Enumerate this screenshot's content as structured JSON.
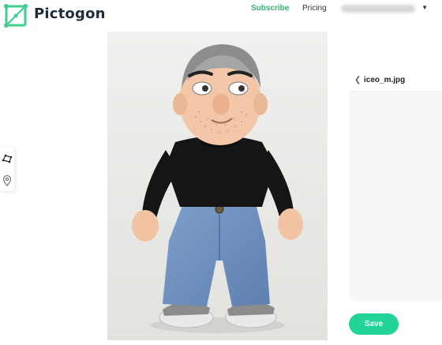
{
  "header": {
    "brand": "Pictogon",
    "logo_icon": "pictogon-logo-icon",
    "nav": {
      "subscribe": "Subscribe",
      "pricing": "Pricing"
    },
    "account": {
      "caret_icon": "caret-down-icon"
    },
    "accent_color": "#2bb673"
  },
  "toolbar": {
    "tools": [
      "polygon-tool-icon",
      "location-pin-icon"
    ]
  },
  "canvas": {
    "image_description_icon": "photo"
  },
  "panel": {
    "back_icon": "chevron-left-icon",
    "file_name": "iceo_m.jpg"
  },
  "actions": {
    "save_label": "Save",
    "save_color": "#22d39a"
  }
}
